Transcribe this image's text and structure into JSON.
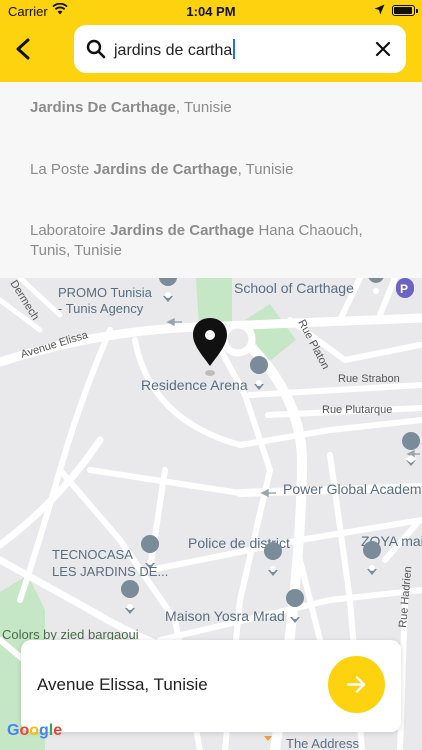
{
  "status_bar": {
    "carrier": "Carrier",
    "time": "1:04 PM",
    "battery_level": 0.95
  },
  "search": {
    "value": "jardins de cartha"
  },
  "suggestions": [
    {
      "plain_before": "",
      "bold": "Jardins De Carthage",
      "plain_after": ", Tunisie"
    },
    {
      "plain_before": "La Poste ",
      "bold": "Jardins de Carthage",
      "plain_after": ", Tunisie"
    },
    {
      "plain_before": "Laboratoire ",
      "bold": "Jardins de Carthage",
      "plain_after": " Hana Chaouch, Tunis, Tunisie"
    }
  ],
  "map": {
    "pois": [
      {
        "name": "School of Carthage"
      },
      {
        "name": "PROMO Tunisia - Tunis Agency"
      },
      {
        "name": "Residence Arena"
      },
      {
        "name": "Power Global Academy"
      },
      {
        "name": "Police de district"
      },
      {
        "name": "TECNOCASA LES JARDINS DE..."
      },
      {
        "name": "ZOYA mai"
      },
      {
        "name": "Maison Yosra Mrad"
      },
      {
        "name": "Colors by zied bargaoui"
      },
      {
        "name": "The Address"
      }
    ],
    "streets": [
      "Avenue Elissa",
      "Rue Platon",
      "Rue Strabon",
      "Rue Plutarque",
      "Dermech",
      "Rue Hadrien"
    ],
    "logo": "Google"
  },
  "address_card": {
    "address": "Avenue Elissa, Tunisie"
  },
  "colors": {
    "accent": "#fdd20f",
    "map_bg": "#e9e9eb",
    "road": "#ffffff",
    "park": "#c6e7c6",
    "poi_marker": "#7a8c99"
  }
}
